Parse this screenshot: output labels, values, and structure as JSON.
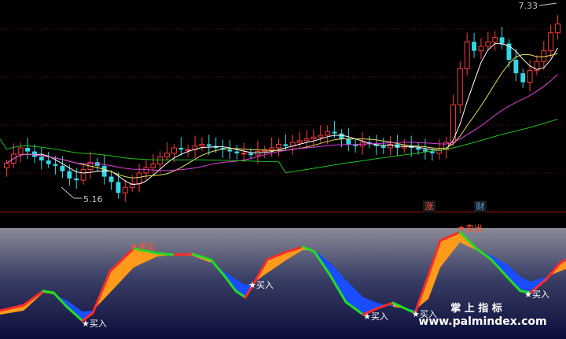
{
  "price_panel": {
    "high_label": "7.33",
    "low_label": "5.16",
    "badges": [
      {
        "text": "涨",
        "color": "#ff4a4a"
      },
      {
        "text": "财",
        "color": "#5aa8ff"
      }
    ],
    "closes": [
      5.55,
      5.65,
      5.72,
      5.68,
      5.62,
      5.58,
      5.54,
      5.52,
      5.46,
      5.38,
      5.36,
      5.48,
      5.56,
      5.52,
      5.4,
      5.34,
      5.22,
      5.28,
      5.32,
      5.44,
      5.5,
      5.54,
      5.62,
      5.66,
      5.72,
      5.7,
      5.7,
      5.74,
      5.76,
      5.74,
      5.72,
      5.7,
      5.68,
      5.66,
      5.66,
      5.64,
      5.68,
      5.7,
      5.72,
      5.76,
      5.74,
      5.78,
      5.8,
      5.82,
      5.84,
      5.86,
      5.9,
      5.88,
      5.82,
      5.76,
      5.74,
      5.78,
      5.76,
      5.74,
      5.72,
      5.76,
      5.72,
      5.74,
      5.72,
      5.7,
      5.68,
      5.66,
      5.7,
      5.78,
      6.2,
      6.6,
      6.9,
      6.8,
      6.85,
      6.9,
      6.95,
      6.88,
      6.7,
      6.55,
      6.45,
      6.58,
      6.68,
      6.8,
      7.0,
      7.1
    ]
  },
  "indicator_panel": {
    "buy_label": "★买入",
    "sell_label": "★卖出",
    "buy_signals": [
      {
        "text": "★买入"
      },
      {
        "text": "★买入"
      },
      {
        "text": "★买入"
      },
      {
        "text": "★买入"
      },
      {
        "text": "★买入"
      }
    ],
    "sell_signals": [
      {
        "text": "★卖出"
      },
      {
        "text": "★卖出"
      }
    ],
    "colors": {
      "rising": "#ff2a2a",
      "falling": "#22dd22",
      "fill_up": "#ff9a1a",
      "fill_down": "#1a4dff",
      "star": "#ffee00"
    }
  },
  "watermark": {
    "title": "掌 上 指 标",
    "url": "www.palmindex.com"
  }
}
